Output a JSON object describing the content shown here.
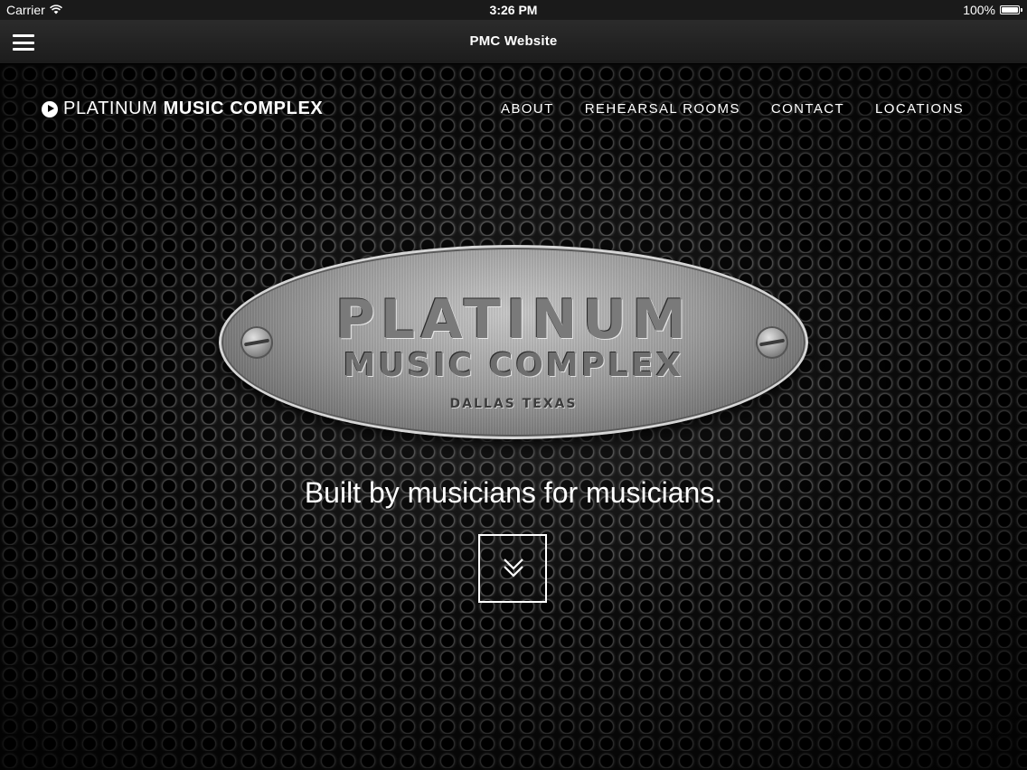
{
  "status_bar": {
    "carrier": "Carrier",
    "time": "3:26 PM",
    "battery": "100%",
    "battery_level": 1.0,
    "icons": [
      "wifi-icon",
      "battery-icon"
    ]
  },
  "nav_bar": {
    "title": "PMC Website",
    "menu_icon": "hamburger-menu-icon"
  },
  "site_header": {
    "brand_light": "PLATINUM",
    "brand_bold": "MUSIC COMPLEX",
    "brand_icon": "play-circle-icon",
    "nav": [
      "ABOUT",
      "REHEARSAL ROOMS",
      "CONTACT",
      "LOCATIONS"
    ]
  },
  "hero": {
    "plaque_title": "PLATINUM",
    "plaque_subtitle": "MUSIC COMPLEX",
    "plaque_location": "DALLAS TEXAS",
    "tagline": "Built by musicians for musicians.",
    "scroll_icon": "double-chevron-down-icon"
  },
  "colors": {
    "background": "#050505",
    "text": "#ffffff",
    "status_bar": "#1a1a1a"
  }
}
